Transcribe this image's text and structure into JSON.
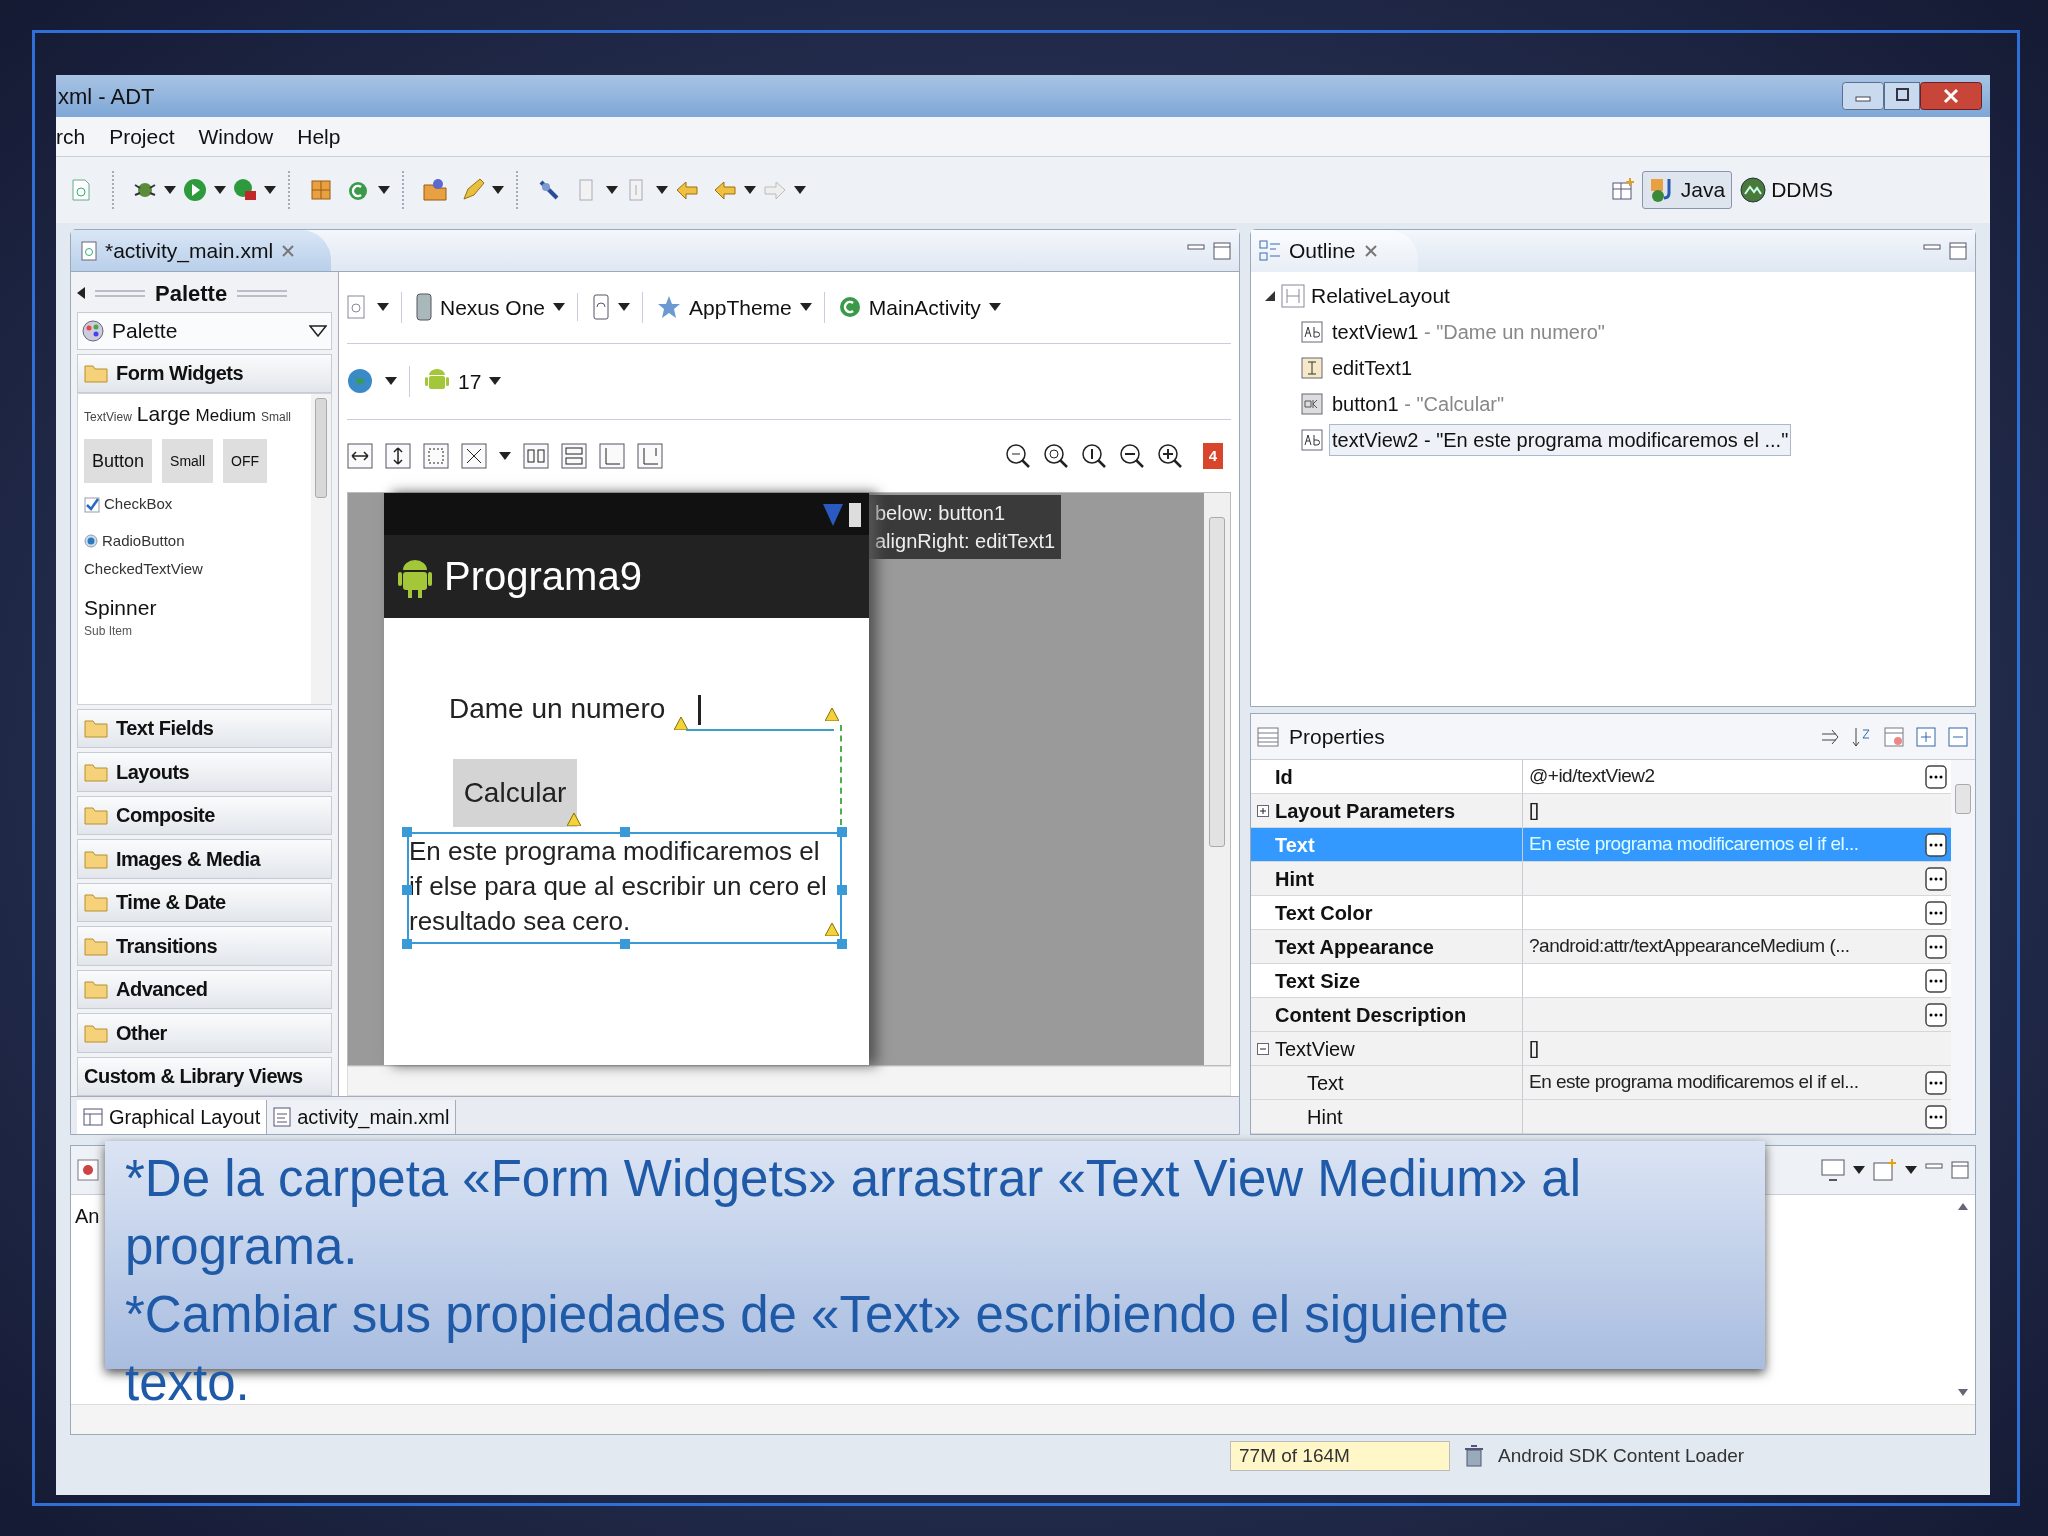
{
  "window": {
    "title": "xml - ADT"
  },
  "menu": [
    "rch",
    "Project",
    "Window",
    "Help"
  ],
  "perspectives": [
    {
      "label": "Java",
      "selected": true
    },
    {
      "label": "DDMS",
      "selected": false
    }
  ],
  "editor": {
    "tab": "*activity_main.xml",
    "palette": {
      "header": "Palette",
      "dropdown": "Palette",
      "open_category": "Form Widgets",
      "textviews": [
        {
          "label": "TextView",
          "kind": "tiny"
        },
        {
          "label": "Large",
          "kind": "large"
        },
        {
          "label": "Medium",
          "kind": "medium"
        },
        {
          "label": "Small",
          "kind": "tiny"
        }
      ],
      "widget_buttons": [
        "Button",
        "Small",
        "OFF"
      ],
      "checkbox": {
        "label": "CheckBox",
        "checked": true
      },
      "radio": {
        "label": "RadioButton",
        "checked": true
      },
      "checked_text_view": "CheckedTextView",
      "spinner": "Spinner",
      "spinner_sub": "Sub Item",
      "categories": [
        "Text Fields",
        "Layouts",
        "Composite",
        "Images & Media",
        "Time & Date",
        "Transitions",
        "Advanced",
        "Other"
      ],
      "footer": "Custom & Library Views"
    },
    "toolbar": {
      "device": "Nexus One",
      "theme": "AppTheme",
      "activity": "MainActivity",
      "api": "17",
      "errors": "4"
    },
    "phone": {
      "app_title": "Programa9",
      "label": "Dame un numero",
      "button": "Calcular",
      "text": "En este programa modificaremos el if else para que al escribir un cero el resultado sea cero.",
      "tooltip": [
        "below: button1",
        "alignRight: editText1"
      ]
    },
    "bottom_tabs": [
      {
        "label": "Graphical Layout",
        "selected": true
      },
      {
        "label": "activity_main.xml",
        "selected": false
      }
    ]
  },
  "outline": {
    "title": "Outline",
    "tree": [
      {
        "label": "RelativeLayout",
        "expanded": true,
        "children": [
          {
            "label": "textView1",
            "detail": "- \"Dame un numero\"",
            "kind": "textview",
            "selected": false
          },
          {
            "label": "editText1",
            "kind": "edittext",
            "selected": false
          },
          {
            "label": "button1",
            "detail": "- \"Calcular\"",
            "kind": "button",
            "selected": false
          },
          {
            "label": "textView2",
            "detail": "- \"En este programa modificaremos el ...\"",
            "kind": "textview",
            "selected": true
          }
        ]
      }
    ]
  },
  "properties": {
    "title": "Properties",
    "rows": [
      {
        "name": "Id",
        "value": "@+id/textView2",
        "kind": "property",
        "selected": false
      },
      {
        "name": "Layout Parameters",
        "value": "[]",
        "kind": "group",
        "expanded": false,
        "selected": false
      },
      {
        "name": "Text",
        "value": "En este programa modificaremos el if el...",
        "kind": "property",
        "selected": true
      },
      {
        "name": "Hint",
        "kind": "property",
        "selected": false
      },
      {
        "name": "Text Color",
        "kind": "property",
        "selected": false
      },
      {
        "name": "Text Appearance",
        "value": "?android:attr/textAppearanceMedium (...",
        "kind": "property",
        "selected": false
      },
      {
        "name": "Text Size",
        "kind": "property",
        "selected": false
      },
      {
        "name": "Content Description",
        "kind": "property",
        "selected": false
      },
      {
        "name": "TextView",
        "value": "[]",
        "kind": "group",
        "expanded": true,
        "selected": false
      },
      {
        "name": "Text",
        "value": "En este programa modificaremos el if el...",
        "kind": "child",
        "selected": false
      },
      {
        "name": "Hint",
        "kind": "child",
        "selected": false
      }
    ]
  },
  "console": {
    "text": "An"
  },
  "status_bar": {
    "memory": "77M of 164M",
    "job": "Android SDK Content Loader"
  },
  "caption": {
    "paragraphs": [
      "*De la carpeta «Form Widgets» arrastrar «Text View Medium» al programa.",
      "*Cambiar sus propiedades de «Text» escribiendo el siguiente texto."
    ]
  }
}
